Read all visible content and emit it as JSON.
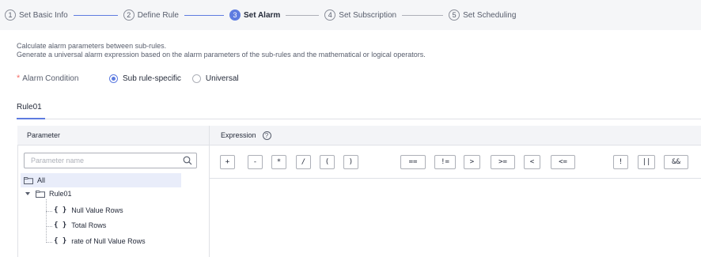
{
  "steps": [
    {
      "num": "1",
      "label": "Set Basic Info"
    },
    {
      "num": "2",
      "label": "Define Rule"
    },
    {
      "num": "3",
      "label": "Set Alarm"
    },
    {
      "num": "4",
      "label": "Set Subscription"
    },
    {
      "num": "5",
      "label": "Set Scheduling"
    }
  ],
  "description": {
    "line1": "Calculate alarm parameters between sub-rules.",
    "line2": "Generate a universal alarm expression based on the alarm parameters of the sub-rules and the mathematical or logical operators."
  },
  "alarm_condition": {
    "required_mark": "*",
    "label": "Alarm Condition",
    "options": [
      "Sub rule-specific",
      "Universal"
    ],
    "selected": "Sub rule-specific"
  },
  "rule_tab": "Rule01",
  "table": {
    "param_header": "Parameter",
    "expr_header": "Expression",
    "help_glyph": "?"
  },
  "search": {
    "placeholder": "Parameter name"
  },
  "tree": {
    "root": "All",
    "rule": "Rule01",
    "leaf_glyph": "{ }",
    "leaves": [
      "Null Value Rows",
      "Total Rows",
      "rate of Null Value Rows"
    ]
  },
  "operators": [
    "+",
    "-",
    "*",
    "/",
    "(",
    ")",
    "==",
    "!=",
    ">",
    ">=",
    "<",
    "<=",
    "!",
    "||",
    "&&"
  ],
  "colors": {
    "accent": "#5e7ce0",
    "required": "#f66f6a",
    "header_bg": "#f3f4f7",
    "selected_row": "#e9edfa"
  }
}
